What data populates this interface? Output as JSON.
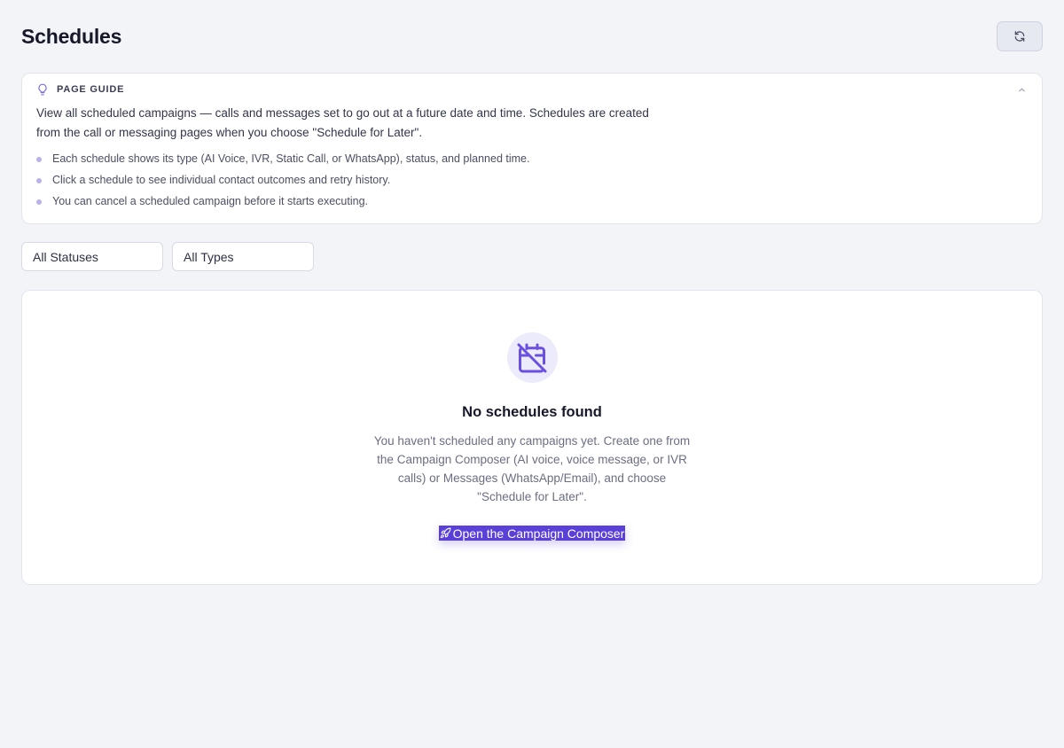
{
  "header": {
    "title": "Schedules",
    "refresh_icon": "refresh-icon"
  },
  "guide": {
    "title": "PAGE GUIDE",
    "icon": "lightbulb-icon",
    "intro": "View all scheduled campaigns — calls and messages set to go out at a future date and time. Schedules are created from the call or messaging pages when you choose \"Schedule for Later\".",
    "items": [
      "Each schedule shows its type (AI Voice, IVR, Static Call, or WhatsApp), status, and planned time.",
      "Click a schedule to see individual contact outcomes and retry history.",
      "You can cancel a scheduled campaign before it starts executing."
    ]
  },
  "filters": {
    "status": "All Statuses",
    "type": "All Types"
  },
  "empty_state": {
    "icon": "calendar-off-icon",
    "title": "No schedules found",
    "description": "You haven't scheduled any campaigns yet. Create one from the Campaign Composer (AI voice, voice message, or IVR calls) or Messages (WhatsApp/Email), and choose \"Schedule for Later\".",
    "cta_label": "Open the Campaign Composer",
    "cta_icon": "rocket-icon"
  },
  "colors": {
    "accent": "#5b3fd9",
    "background": "#f3f4f8",
    "icon_circle": "#ecebfb"
  }
}
